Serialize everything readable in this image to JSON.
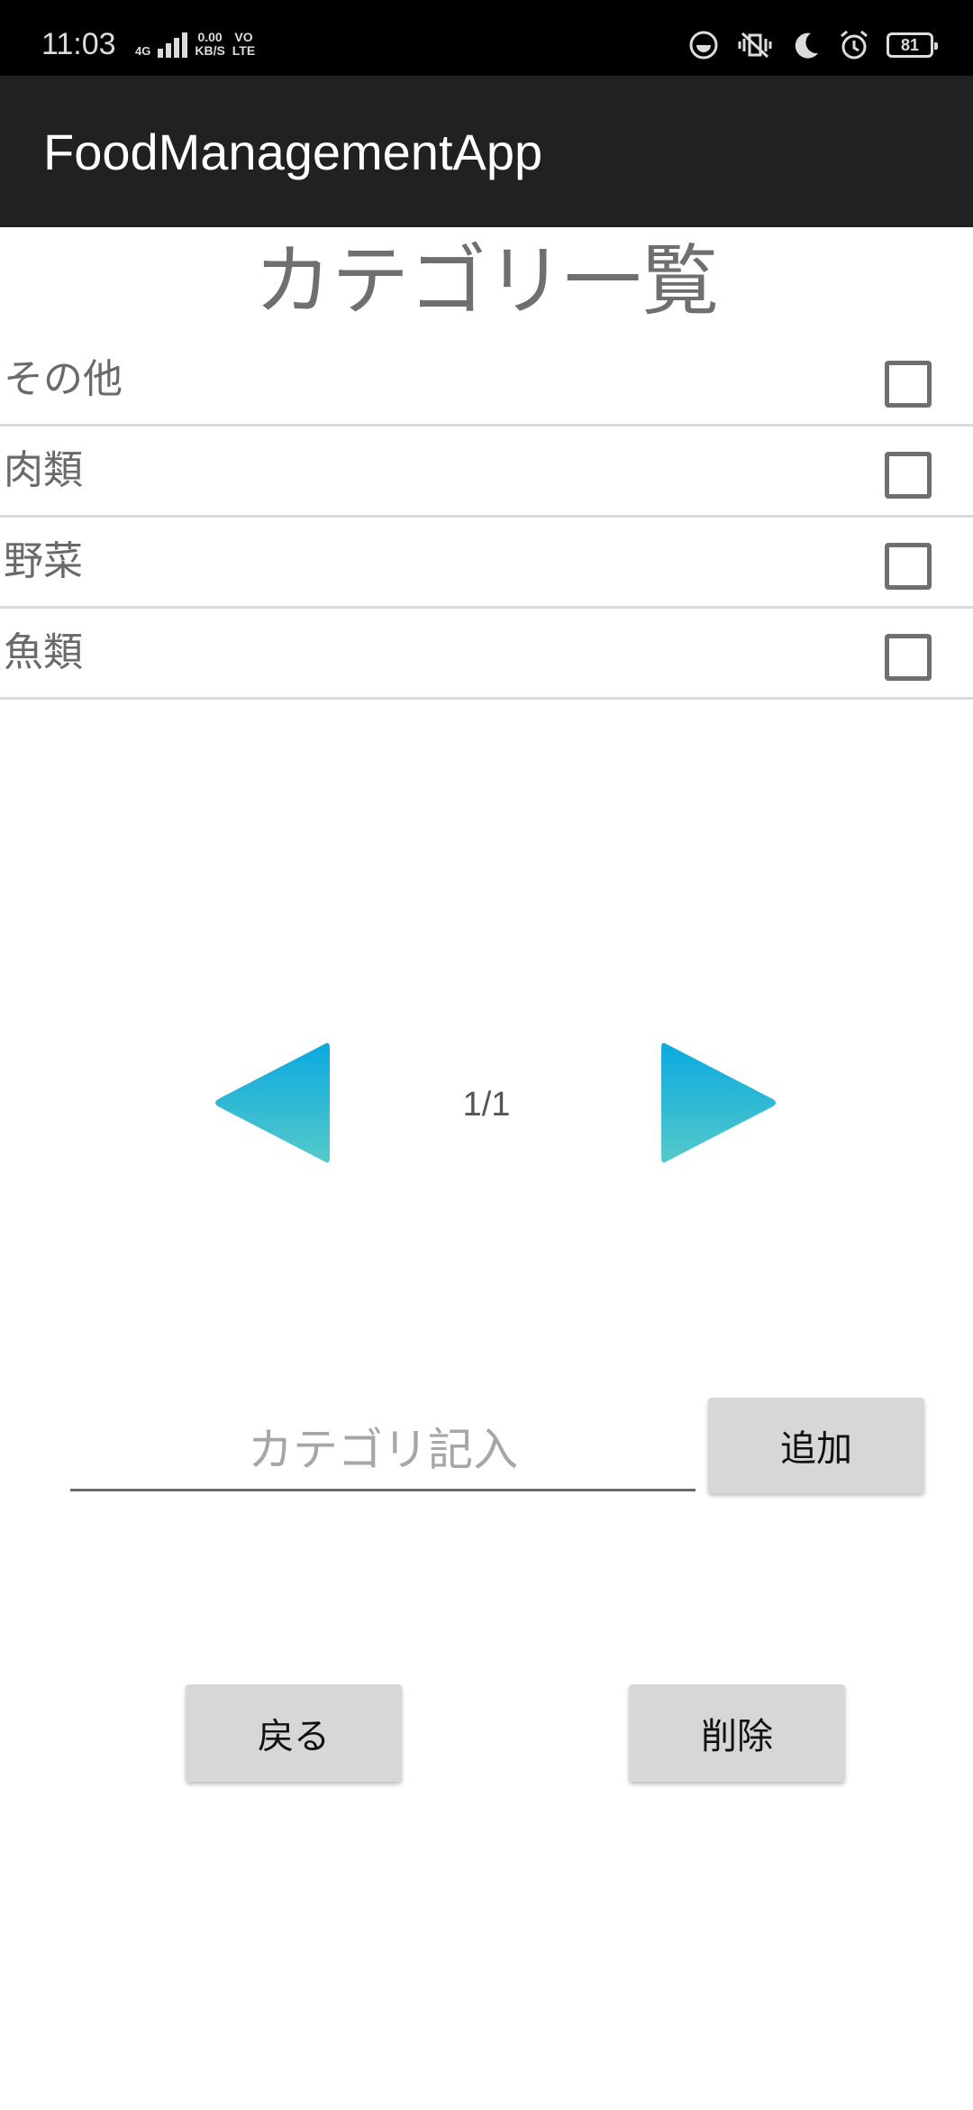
{
  "status_bar": {
    "time": "11:03",
    "network_type": "4G",
    "data_speed": "0.00\nKB/S",
    "volte": "VO\nLTE",
    "battery_level": "81"
  },
  "app_bar": {
    "title": "FoodManagementApp"
  },
  "page": {
    "heading": "カテゴリ一覧"
  },
  "categories": [
    {
      "label": "その他",
      "checked": false
    },
    {
      "label": "肉類",
      "checked": false
    },
    {
      "label": "野菜",
      "checked": false
    },
    {
      "label": "魚類",
      "checked": false
    }
  ],
  "pager": {
    "indicator": "1/1",
    "prev_icon": "triangle-left-icon",
    "next_icon": "triangle-right-icon",
    "gradient_top": "#0aa9e0",
    "gradient_bottom": "#55c9c9"
  },
  "category_input": {
    "placeholder": "カテゴリ記入",
    "value": ""
  },
  "buttons": {
    "add": "追加",
    "back": "戻る",
    "delete": "削除"
  },
  "colors": {
    "status_bar": "#000000",
    "app_bar": "#212121",
    "button_bg": "#d6d7d7"
  }
}
